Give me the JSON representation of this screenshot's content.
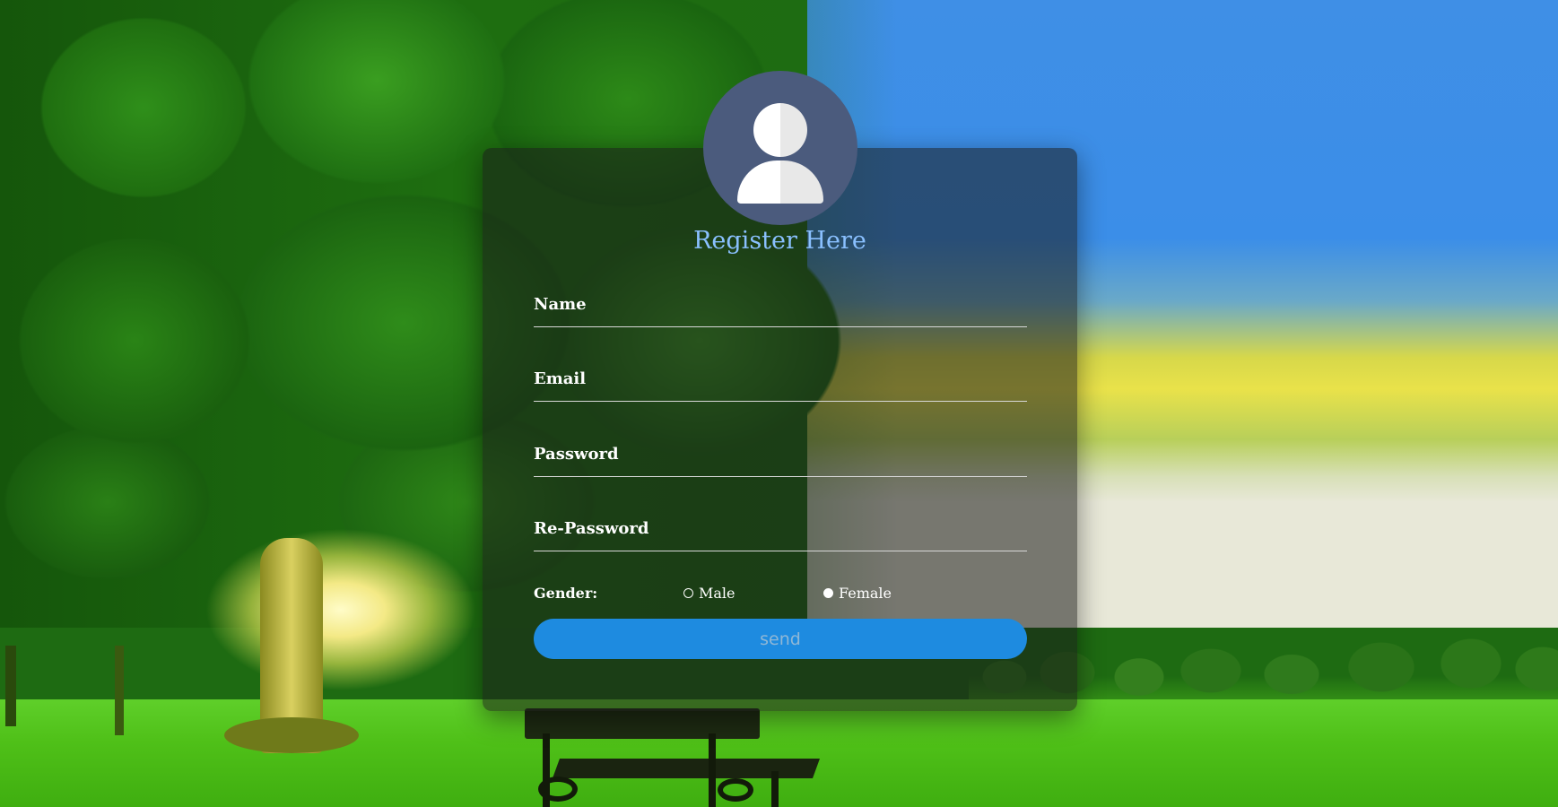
{
  "form": {
    "title": "Register Here",
    "avatar_icon": "user-silhouette-icon",
    "fields": [
      {
        "label": "Name",
        "value": ""
      },
      {
        "label": "Email",
        "value": ""
      },
      {
        "label": "Password",
        "value": ""
      },
      {
        "label": "Re-Password",
        "value": ""
      }
    ],
    "gender": {
      "label": "Gender:",
      "options": [
        {
          "label": "Male",
          "selected": false
        },
        {
          "label": "Female",
          "selected": true
        }
      ]
    },
    "submit_label": "send"
  },
  "colors": {
    "title": "#8ac0ff",
    "button": "#1e8be0",
    "avatar_bg": "#4b5b7d",
    "card_overlay": "rgba(25,25,25,0.55)"
  }
}
